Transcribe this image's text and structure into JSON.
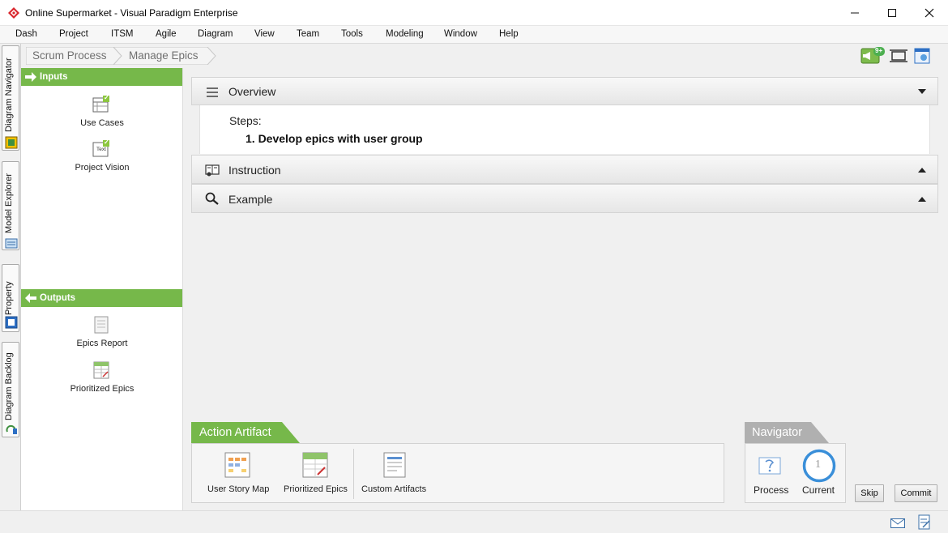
{
  "window": {
    "title": "Online Supermarket - Visual Paradigm Enterprise",
    "minimize_glyph": "—",
    "maximize_glyph": "☐",
    "close_glyph": "✕"
  },
  "menu": [
    "Dash",
    "Project",
    "ITSM",
    "Agile",
    "Diagram",
    "View",
    "Team",
    "Tools",
    "Modeling",
    "Window",
    "Help"
  ],
  "side_tabs": [
    "Diagram Navigator",
    "Model Explorer",
    "Property",
    "Diagram Backlog"
  ],
  "breadcrumb": [
    "Scrum Process",
    "Manage Epics"
  ],
  "toolbar": {
    "notification_badge": "9+",
    "icons": [
      "megaphone-icon",
      "fit-screen-icon",
      "panel-window-icon"
    ]
  },
  "inputs": {
    "header": "Inputs",
    "items": [
      {
        "label": "Use Cases",
        "icon": "use-case-artifact-icon",
        "check": "✓"
      },
      {
        "label": "Project Vision",
        "icon": "text-artifact-icon",
        "icon_text": "Text",
        "check": "✓"
      }
    ]
  },
  "outputs": {
    "header": "Outputs",
    "items": [
      {
        "label": "Epics Report",
        "icon": "report-artifact-icon"
      },
      {
        "label": "Prioritized Epics",
        "icon": "prioritized-epics-icon"
      }
    ]
  },
  "overview": {
    "title": "Overview",
    "steps_label": "Steps:",
    "steps": [
      "1. Develop epics with user group"
    ]
  },
  "instruction": {
    "title": "Instruction"
  },
  "example": {
    "title": "Example"
  },
  "action_artifact": {
    "header": "Action Artifact",
    "items": [
      "User Story Map",
      "Prioritized Epics",
      "Custom Artifacts"
    ]
  },
  "navigator": {
    "header": "Navigator",
    "process_label": "Process",
    "current_label": "Current",
    "current_step": "1"
  },
  "buttons": {
    "skip": "Skip",
    "commit": "Commit"
  },
  "colors": {
    "green": "#76b84a",
    "gray_tab": "#b0b0b0",
    "navigator_ring": "#3a8fd9"
  }
}
